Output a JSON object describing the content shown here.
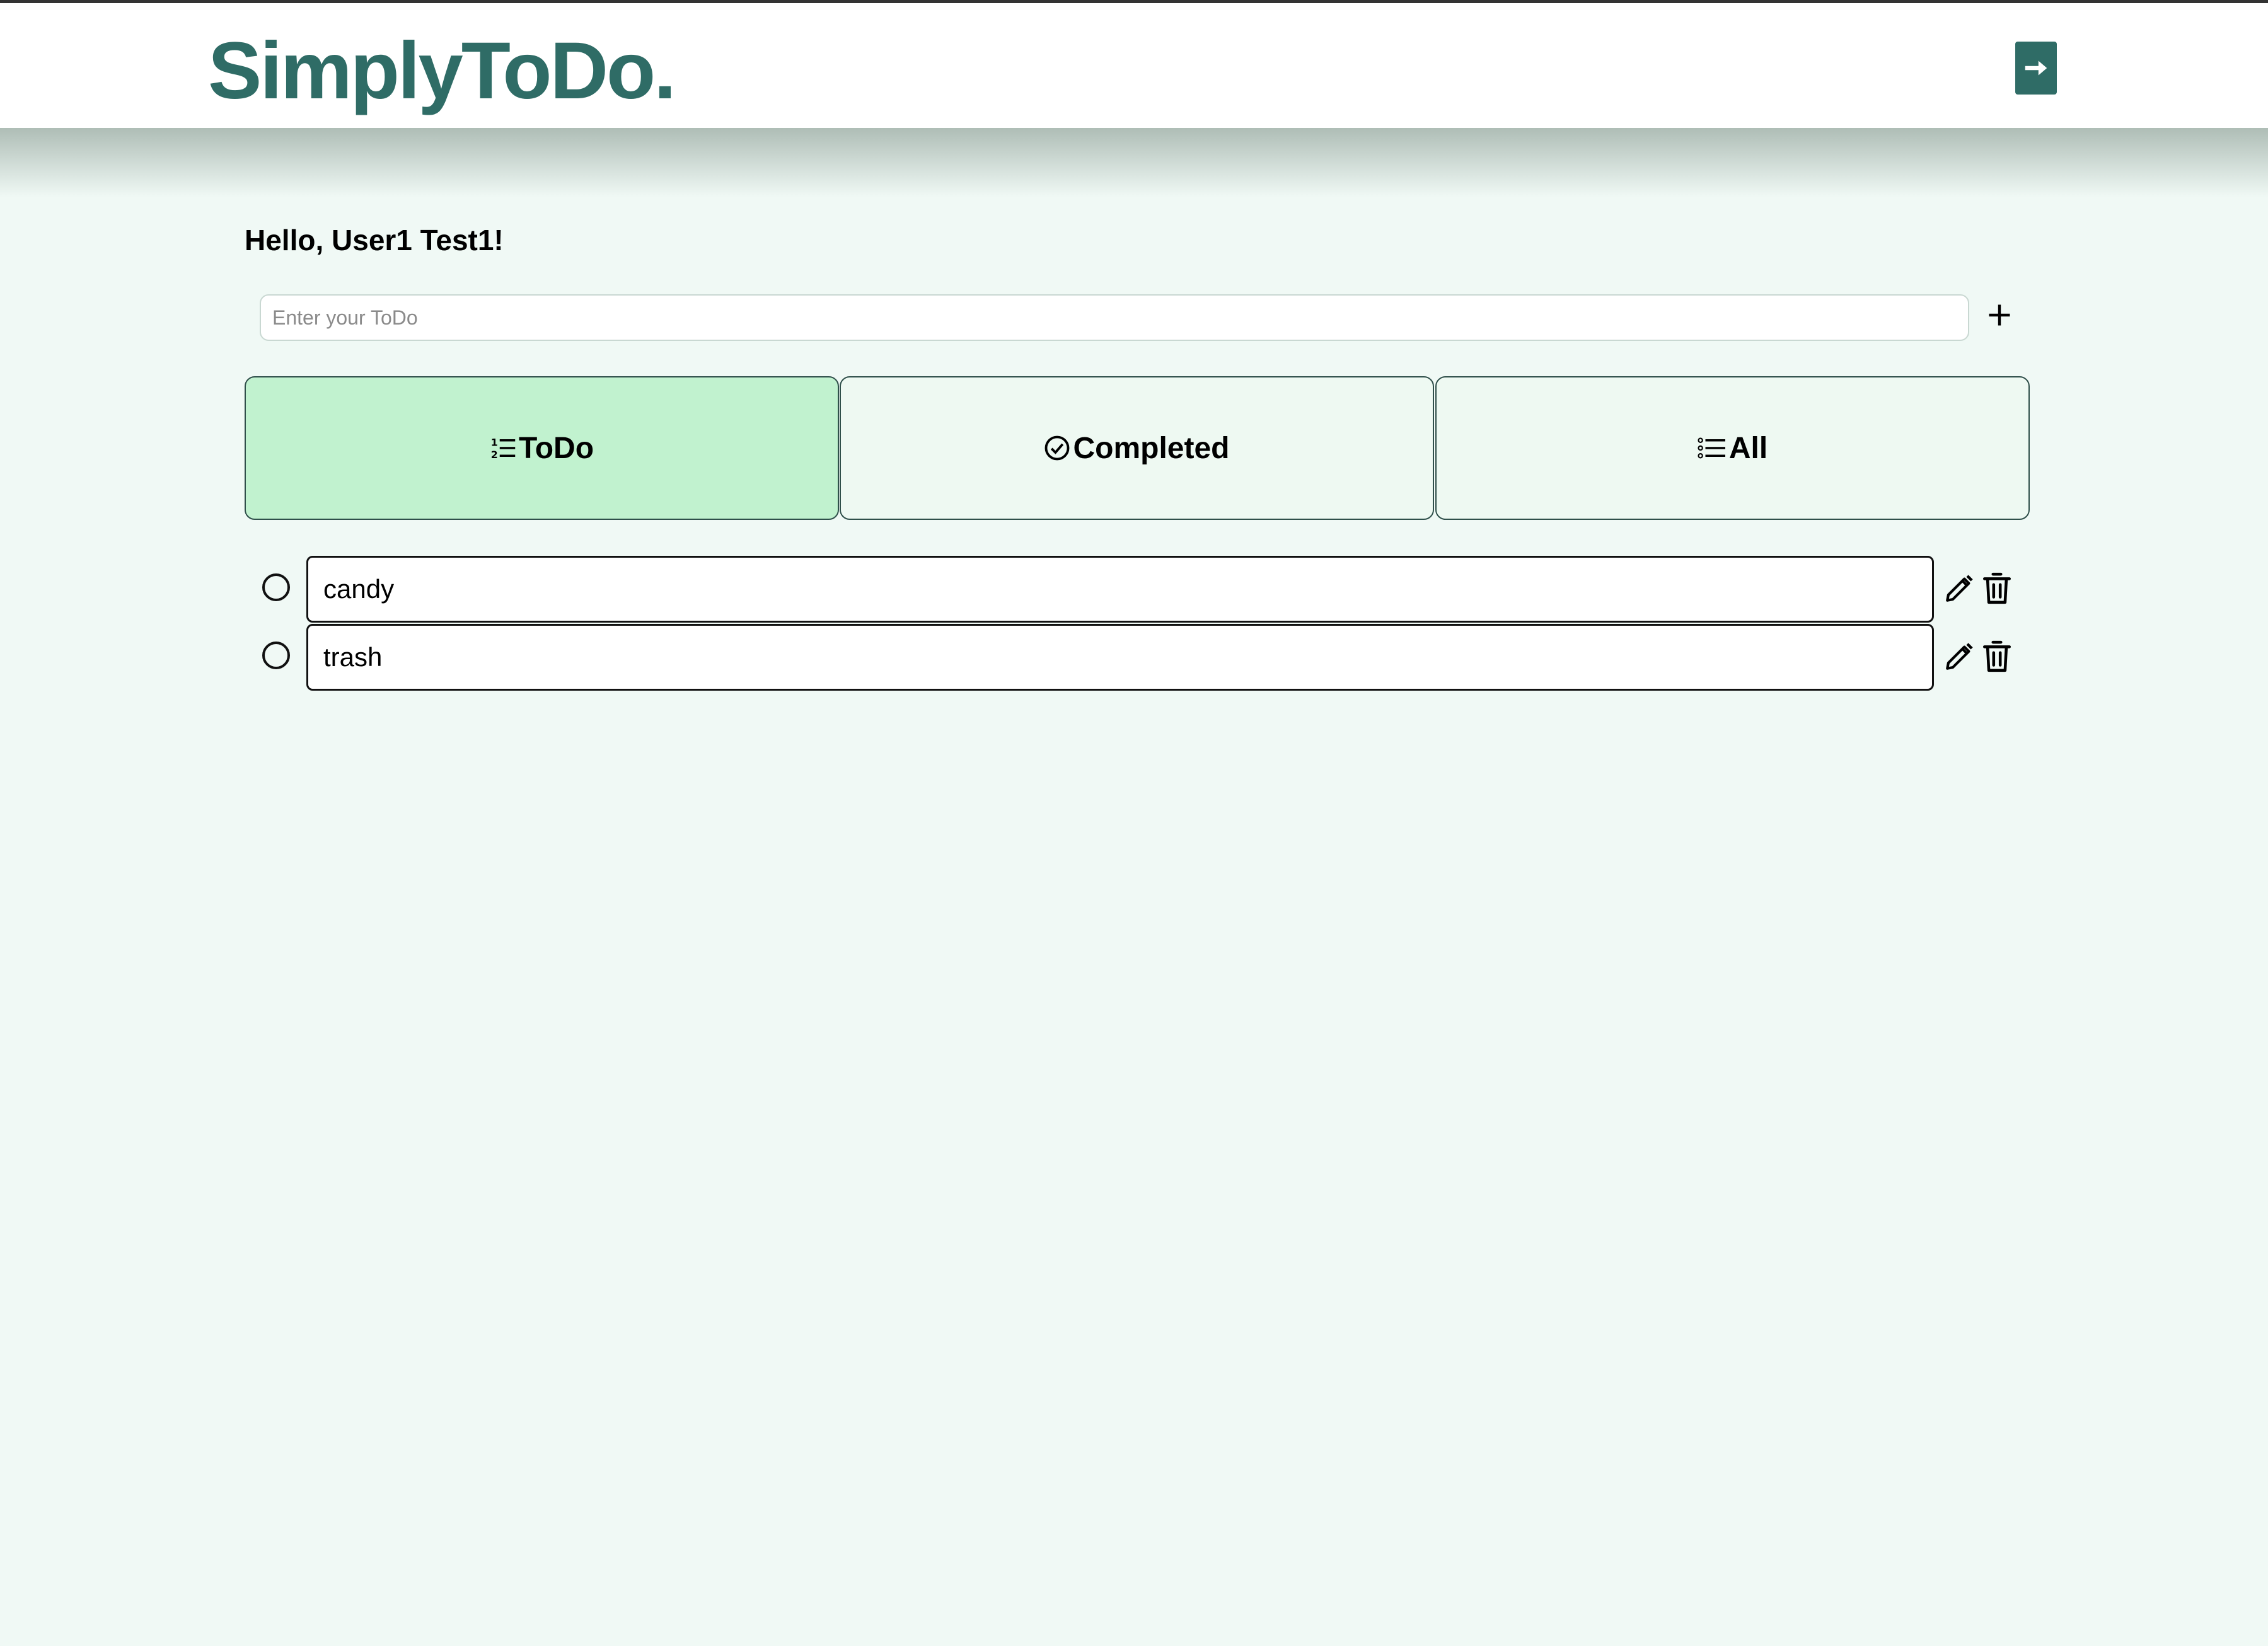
{
  "header": {
    "logo": "SimplyToDo.",
    "logout_icon": "logout-arrow-icon"
  },
  "greeting": "Hello, User1 Test1!",
  "new_todo": {
    "placeholder": "Enter your ToDo",
    "value": "",
    "add_icon": "plus-icon"
  },
  "tabs": [
    {
      "label": "ToDo",
      "icon": "numbered-list-icon",
      "active": true
    },
    {
      "label": "Completed",
      "icon": "check-circle-icon",
      "active": false
    },
    {
      "label": "All",
      "icon": "bullet-list-icon",
      "active": false
    }
  ],
  "todos": [
    {
      "text": "candy",
      "completed": false
    },
    {
      "text": "trash",
      "completed": false
    }
  ],
  "colors": {
    "brand": "#2f6c66",
    "page_background": "#f0f9f5",
    "active_tab": "#c1f2cf",
    "inactive_tab": "#eef9f2"
  }
}
